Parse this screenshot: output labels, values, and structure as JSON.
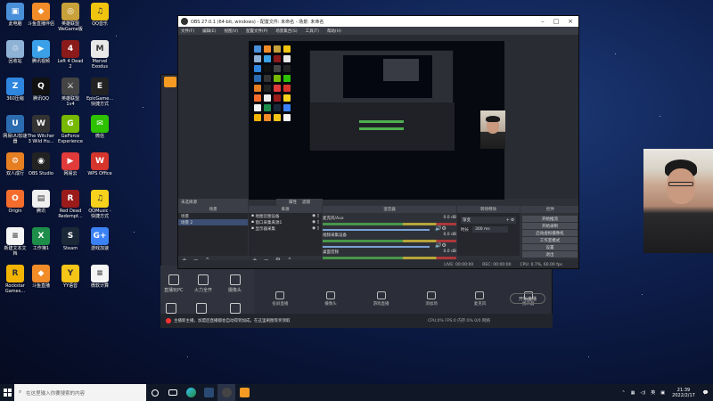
{
  "desktop_icons": [
    {
      "label": "此电脑",
      "color": "#4a90d9",
      "glyph": "▣"
    },
    {
      "label": "斗鱼直播伴侣",
      "color": "#f28c28",
      "glyph": "◆"
    },
    {
      "label": "英雄联盟 WeGame版",
      "color": "#c9a13a",
      "glyph": "◎"
    },
    {
      "label": "QQ音乐",
      "color": "#f1c40f",
      "glyph": "♫"
    },
    {
      "label": "回收站",
      "color": "#8fb3d6",
      "glyph": "♲"
    },
    {
      "label": "腾讯视频",
      "color": "#3aa0e8",
      "glyph": "▶"
    },
    {
      "label": "Left 4 Dead\n2",
      "color": "#8b1a1a",
      "glyph": "4"
    },
    {
      "label": "Marvel\nExodus",
      "color": "#e8e8e8",
      "glyph": "M"
    },
    {
      "label": "360压缩",
      "color": "#2e86de",
      "glyph": "Z"
    },
    {
      "label": "腾讯QQ",
      "color": "#111111",
      "glyph": "Q"
    },
    {
      "label": "英雄联盟\n1v4",
      "color": "#444444",
      "glyph": "⚔"
    },
    {
      "label": "EpicGame...\n快捷方式",
      "color": "#222222",
      "glyph": "E"
    },
    {
      "label": "网易UU加速\n器",
      "color": "#2b6cb0",
      "glyph": "U"
    },
    {
      "label": "The Witcher\n3 Wild Hu...",
      "color": "#333333",
      "glyph": "W"
    },
    {
      "label": "GeForce\nExperience",
      "color": "#76b900",
      "glyph": "G"
    },
    {
      "label": "微信",
      "color": "#2dc100",
      "glyph": "✉"
    },
    {
      "label": "双人成行",
      "color": "#e67e22",
      "glyph": "⚙"
    },
    {
      "label": "OBS Studio",
      "color": "#222222",
      "glyph": "◉"
    },
    {
      "label": "网易云",
      "color": "#e03a3a",
      "glyph": "▶"
    },
    {
      "label": "WPS Office",
      "color": "#d6352c",
      "glyph": "W"
    },
    {
      "label": "Origin",
      "color": "#f56c2d",
      "glyph": "O"
    },
    {
      "label": "腾讯",
      "color": "#f0f0f0",
      "glyph": "▤"
    },
    {
      "label": "Red Dead\nRedempt...",
      "color": "#9b1b1b",
      "glyph": "R"
    },
    {
      "label": "QQMusic -\n快捷方式",
      "color": "#f7d21c",
      "glyph": "♫"
    },
    {
      "label": "新建文本文\n档",
      "color": "#f5f5f5",
      "glyph": "≡"
    },
    {
      "label": "工作簿1",
      "color": "#1d8f4b",
      "glyph": "X"
    },
    {
      "label": "Steam",
      "color": "#1b2838",
      "glyph": "S"
    },
    {
      "label": "游戏加速",
      "color": "#3b82f6",
      "glyph": "G+"
    },
    {
      "label": "Rockstar\nGames...",
      "color": "#f2b400",
      "glyph": "R"
    },
    {
      "label": "斗鱼直播",
      "color": "#f28c28",
      "glyph": "◆"
    },
    {
      "label": "YY语音",
      "color": "#f5c518",
      "glyph": "Y"
    },
    {
      "label": "微软计算",
      "color": "#f5f5f5",
      "glyph": "≡"
    }
  ],
  "bg_app": {
    "tools": [
      {
        "label": "直播玩PC"
      },
      {
        "label": "火力全开"
      },
      {
        "label": "摄像头"
      },
      {
        "label": "直播"
      },
      {
        "label": "互动"
      },
      {
        "label": "设置"
      }
    ],
    "bottom_tools": [
      {
        "label": "投屏直播"
      },
      {
        "label": "摄像头"
      },
      {
        "label": "游戏直播"
      },
      {
        "label": "添加场"
      },
      {
        "label": "麦克风"
      },
      {
        "label": "扬声器"
      }
    ],
    "start_label": "开始直播",
    "notice": "主播新主播，加盟后直播都会自动得到加成，在这里刷图等奖领取",
    "status": "CPU:0%  FPS:0  内存:0%  0/0  网络"
  },
  "obs": {
    "title": "OBS 27.0.1 (64-bit, windows) - 配置文件: 未命名 - 场景: 未命名",
    "menu": [
      "文件(F)",
      "编辑(E)",
      "视图(V)",
      "配置文件(P)",
      "场景集合(S)",
      "工具(T)",
      "帮助(H)"
    ],
    "scene_label": "未选择源",
    "props_btn": "属性",
    "filters_btn": "滤镜",
    "panels": {
      "scenes": "场景",
      "sources": "来源",
      "mixer": "混音器",
      "transitions": "转场特效",
      "controls": "控件"
    },
    "scenes": [
      "场景",
      "场景 2"
    ],
    "sources": [
      {
        "label": "地图云图设备"
      },
      {
        "label": "窗口采集来源1"
      },
      {
        "label": "显示器采集"
      }
    ],
    "mixer": [
      {
        "label": "麦克风/Aux",
        "level": "0.0 dB"
      },
      {
        "label": "视频采集设备",
        "level": "0.0 dB"
      },
      {
        "label": "桌面音频",
        "level": "0.0 dB"
      }
    ],
    "transition": {
      "type": "渐变",
      "duration_label": "时长",
      "duration": "300 ms"
    },
    "controls": [
      "开始推流",
      "开始录制",
      "启动虚拟摄像机",
      "工作室模式",
      "设置",
      "退出"
    ],
    "status": {
      "live": "LIVE: 00:00:00",
      "rec": "REC: 00:00:00",
      "cpu": "CPU: 0.7%, 60.00 fps"
    }
  },
  "taskbar": {
    "search_placeholder": "在这里输入你要搜索的内容",
    "time": "21:39",
    "date": "2022/2/17",
    "ime": "英",
    "notify": "💬"
  },
  "colors": {
    "accent": "#f59a23",
    "live": "#ff3333"
  }
}
